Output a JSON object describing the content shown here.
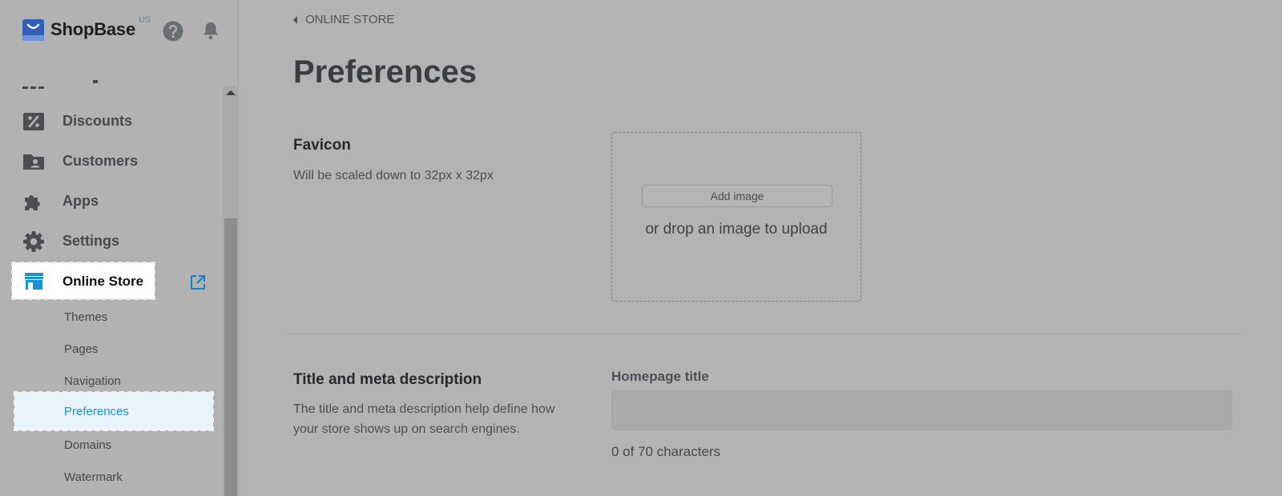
{
  "header": {
    "brand": "ShopBase",
    "region": "US"
  },
  "sidebar": {
    "items": [
      {
        "label": "Discounts",
        "icon": "discount-icon"
      },
      {
        "label": "Customers",
        "icon": "customers-icon"
      },
      {
        "label": "Apps",
        "icon": "puzzle-icon"
      },
      {
        "label": "Settings",
        "icon": "gear-icon"
      }
    ],
    "online_store": {
      "label": "Online Store",
      "icon": "store-icon"
    },
    "sub_items": [
      "Themes",
      "Pages",
      "Navigation",
      "Preferences",
      "Domains",
      "Watermark"
    ],
    "active_sub_item": "Preferences"
  },
  "main": {
    "breadcrumb": "ONLINE STORE",
    "title": "Preferences",
    "favicon": {
      "title": "Favicon",
      "description": "Will be scaled down to 32px x 32px",
      "add_image_label": "Add image",
      "drop_text": "or drop an image to upload"
    },
    "seo": {
      "title": "Title and meta description",
      "description_line1": "The title and meta description help define how",
      "description_line2": "your store shows up on search engines.",
      "homepage_title_label": "Homepage title",
      "homepage_title_value": "",
      "char_count": "0 of 70 characters"
    }
  },
  "colors": {
    "accent": "#1a93d4",
    "overlay": "#b3b3b3"
  }
}
